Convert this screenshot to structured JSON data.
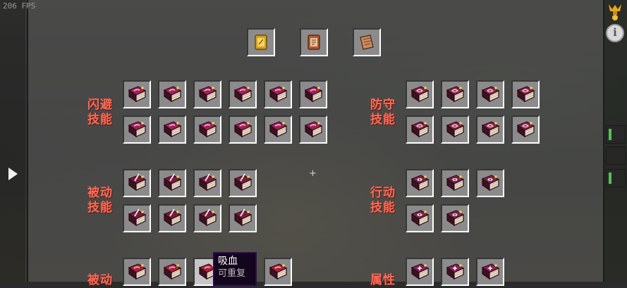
{
  "hud": {
    "fps": "206 FPS"
  },
  "colors": {
    "category_label": "#ff6a56",
    "tooltip_bg": "#12051c",
    "tooltip_border": "#2a0a52",
    "slot_bg": "#8b8b8b"
  },
  "top_scrolls": [
    {
      "icon": "golden-scroll-icon"
    },
    {
      "icon": "scroll-icon"
    },
    {
      "icon": "paper-scroll-icon"
    }
  ],
  "categories": [
    {
      "label": "闪避\n技能",
      "icon": "pink-book-icon",
      "rows": [
        6,
        6
      ]
    },
    {
      "label": "防守\n技能",
      "icon": "bookmark-book-icon",
      "rows": [
        4,
        4
      ]
    },
    {
      "label": "被动\n技能",
      "icon": "quill-book-icon",
      "rows": [
        4,
        4
      ]
    },
    {
      "label": "行动\n技能",
      "icon": "eye-book-icon",
      "rows": [
        3,
        2
      ]
    },
    {
      "label": "被动",
      "icon": "red-book-icon",
      "rows": [
        5
      ]
    },
    {
      "label": "属性",
      "icon": "sparkle-book-icon",
      "rows": [
        3
      ]
    }
  ],
  "tooltip": {
    "title": "吸血",
    "description": "可重复"
  },
  "side": {
    "info_label": "i"
  }
}
